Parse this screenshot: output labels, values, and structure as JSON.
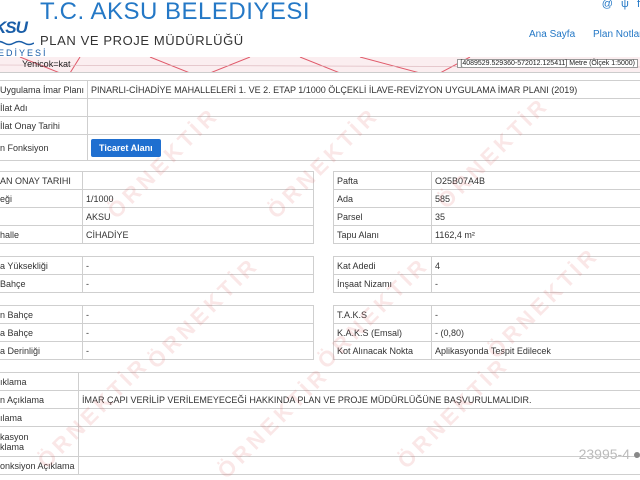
{
  "header": {
    "logo_top": "KSU",
    "logo_bottom": "EDİYESİ",
    "title": "T.C. AKSU BELEDİYESİ",
    "subtitle": "PLAN VE PROJE MÜDÜRLÜĞÜ",
    "social": [
      "@",
      "ψ",
      "f"
    ],
    "nav": [
      "Ana Sayfa",
      "Plan Notları"
    ]
  },
  "map": {
    "label": "Yenicok=kat",
    "coords": "[4089529.529360-572012.125411] Metre (Ölçek 1:5000)"
  },
  "general": [
    {
      "label": "Uygulama İmar Planı",
      "value": "PINARLI-CİHADİYE MAHALLELERİ 1. VE 2. ETAP 1/1000 ÖLÇEKLİ İLAVE-REVİZYON UYGULAMA İMAR PLANI (2019)"
    },
    {
      "label": "İlat Adı",
      "value": ""
    },
    {
      "label": "İlat Onay Tarihi",
      "value": ""
    },
    {
      "label": "n Fonksiyon",
      "value": "",
      "button": "Ticaret Alanı"
    }
  ],
  "left_block": [
    {
      "label": "AN ONAY TARIHI",
      "value": ""
    },
    {
      "label": "eği",
      "value": "1/1000"
    },
    {
      "label": "",
      "value": "AKSU"
    },
    {
      "label": "halle",
      "value": "CİHADİYE"
    }
  ],
  "right_block": [
    {
      "label": "Pafta",
      "value": "O25B07A4B"
    },
    {
      "label": "Ada",
      "value": "585"
    },
    {
      "label": "Parsel",
      "value": "35"
    },
    {
      "label": "Tapu Alanı",
      "value": "1162,4 m²"
    }
  ],
  "left_block2": [
    {
      "label": "a Yüksekliği",
      "value": "-"
    },
    {
      "label": "Bahçe",
      "value": "-"
    }
  ],
  "right_block2": [
    {
      "label": "Kat Adedi",
      "value": "4"
    },
    {
      "label": "İnşaat Nizamı",
      "value": "-"
    }
  ],
  "left_block3": [
    {
      "label": "n Bahçe",
      "value": "-"
    },
    {
      "label": "a Bahçe",
      "value": "-"
    },
    {
      "label": "a Derinliği",
      "value": "-"
    }
  ],
  "right_block3": [
    {
      "label": "T.A.K.S",
      "value": "-"
    },
    {
      "label": "K.A.K.S (Emsal)",
      "value": "- (0,80)"
    },
    {
      "label": "Kot Alınacak Nokta",
      "value": "Aplikasyonda Tespit Edilecek"
    }
  ],
  "notes": [
    {
      "label": "ıklama",
      "value": ""
    },
    {
      "label": "n Açıklama",
      "value": "İMAR ÇAPI VERİLİP VERİLEMEYECEĞİ HAKKINDA PLAN VE PROJE MÜDÜRLÜĞÜNE BAŞVURULMALIDIR."
    },
    {
      "label": "ılama",
      "value": ""
    },
    {
      "label": "kasyon\nklama",
      "value": ""
    },
    {
      "label": "onksiyon Açıklama",
      "value": ""
    }
  ],
  "watermark_text": "ÖRNEKTİR",
  "corner_number": "23995-4",
  "colors": {
    "accent": "#2478c6",
    "button": "#1f6fd0",
    "watermark": "#dc4646"
  }
}
